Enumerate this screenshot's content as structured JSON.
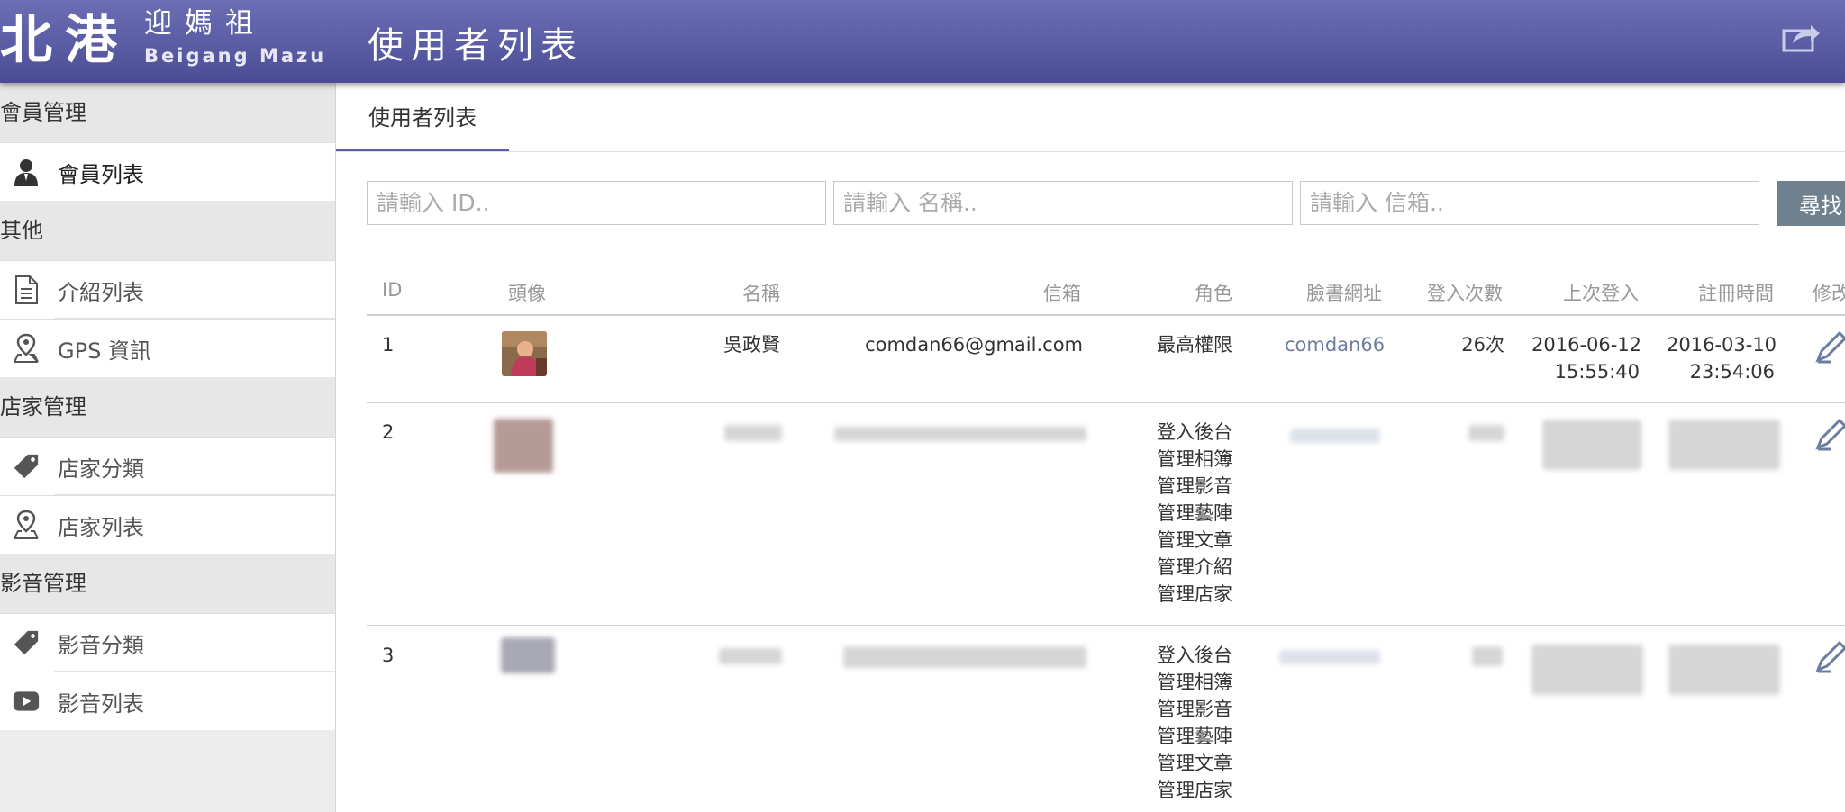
{
  "header": {
    "logo_big": "北港",
    "logo_small_cn": "迎媽祖",
    "logo_small_en": "Beigang Mazu",
    "title": "使用者列表"
  },
  "sidebar": {
    "groups": [
      {
        "title": "會員管理",
        "items": [
          {
            "label": "會員列表",
            "icon": "user-icon"
          }
        ]
      },
      {
        "title": "其他",
        "items": [
          {
            "label": "介紹列表",
            "icon": "document-icon"
          },
          {
            "label": "GPS 資訊",
            "icon": "location-pin-icon"
          }
        ]
      },
      {
        "title": "店家管理",
        "items": [
          {
            "label": "店家分類",
            "icon": "tag-icon"
          },
          {
            "label": "店家列表",
            "icon": "location-pin-icon"
          }
        ]
      },
      {
        "title": "影音管理",
        "items": [
          {
            "label": "影音分類",
            "icon": "tag-icon"
          },
          {
            "label": "影音列表",
            "icon": "youtube-icon"
          }
        ]
      }
    ]
  },
  "main": {
    "tab": "使用者列表",
    "search": {
      "id_placeholder": "請輸入 ID..",
      "name_placeholder": "請輸入 名稱..",
      "email_placeholder": "請輸入 信箱..",
      "button": "尋找"
    },
    "table": {
      "headers": [
        "ID",
        "頭像",
        "名稱",
        "信箱",
        "角色",
        "臉書網址",
        "登入次數",
        "上次登入",
        "註冊時間",
        "修改"
      ],
      "rows": [
        {
          "id": "1",
          "name": "吳政賢",
          "email": "comdan66@gmail.com",
          "roles": [
            "最高權限"
          ],
          "facebook": "comdan66",
          "login_count": "26次",
          "last_login": [
            "2016-06-12",
            "15:55:40"
          ],
          "registered": [
            "2016-03-10",
            "23:54:06"
          ]
        },
        {
          "id": "2",
          "roles": [
            "登入後台",
            "管理相簿",
            "管理影音",
            "管理藝陣",
            "管理文章",
            "管理介紹",
            "管理店家"
          ]
        },
        {
          "id": "3",
          "roles": [
            "登入後台",
            "管理相簿",
            "管理影音",
            "管理藝陣",
            "管理文章",
            "管理店家"
          ]
        }
      ]
    }
  },
  "colors": {
    "header": "#5a5ca4",
    "accent": "#5a5ca4",
    "search_button": "#6f808f",
    "link": "#6c7ea0"
  }
}
